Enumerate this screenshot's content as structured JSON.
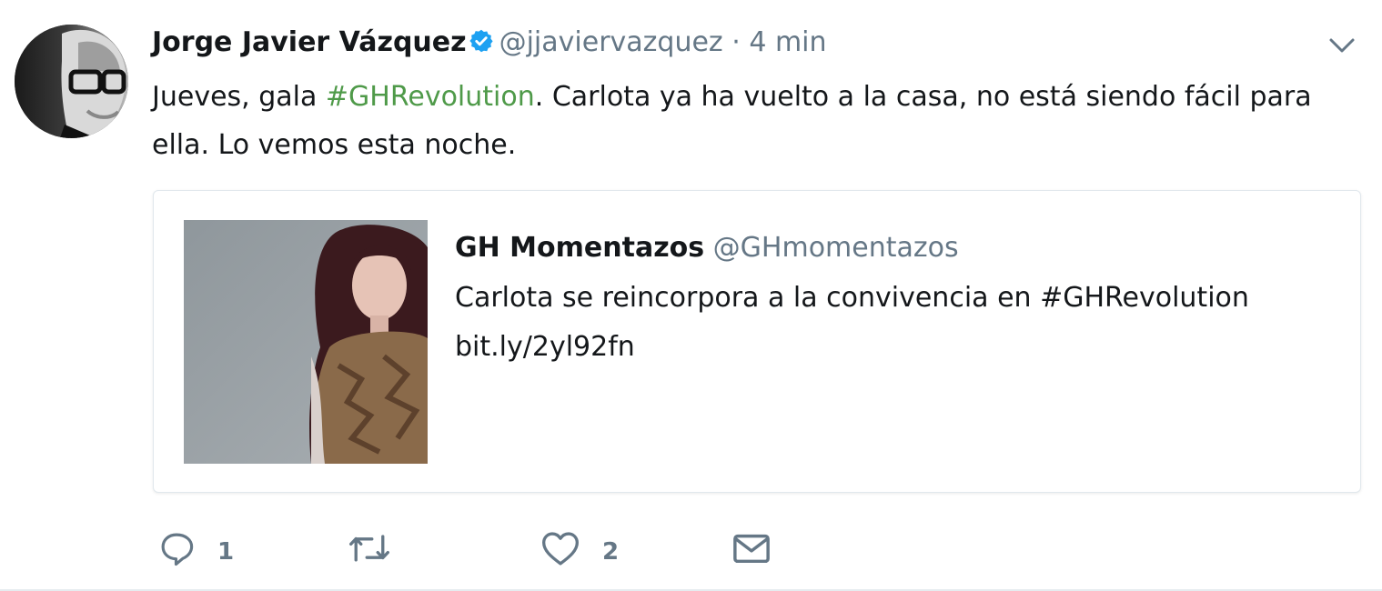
{
  "tweet": {
    "author_name": "Jorge Javier Vázquez",
    "handle": "@jjaviervazquez",
    "separator": "·",
    "time": "4 min",
    "text_before": "Jueves, gala ",
    "hashtag": "#GHRevolution",
    "text_after": ". Carlota ya ha vuelto a la casa, no está siendo fácil para ella. Lo vemos esta noche."
  },
  "card": {
    "name": "GH Momentazos",
    "handle": "@GHmomentazos",
    "description": "Carlota se reincorpora a la convivencia en #GHRevolution",
    "link": "bit.ly/2yl92fn"
  },
  "actions": {
    "reply_count": "1",
    "like_count": "2"
  },
  "icons": {
    "verified": "verified-badge-icon",
    "caret": "chevron-down-icon",
    "reply": "reply-icon",
    "retweet": "retweet-icon",
    "like": "heart-icon",
    "dm": "envelope-icon"
  },
  "colors": {
    "hashtag": "#4f9a49",
    "verified": "#1da1f2",
    "muted": "#657786"
  }
}
